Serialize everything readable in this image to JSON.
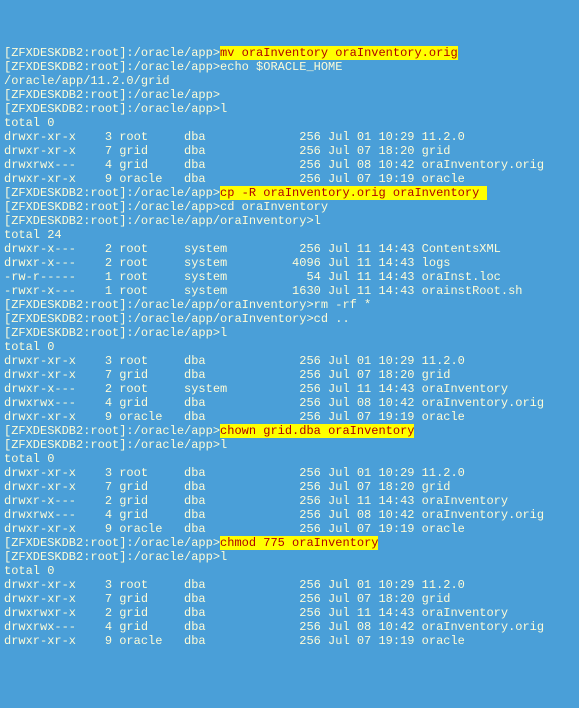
{
  "lines": [
    {
      "segments": [
        {
          "text": "[ZFXDESKDB2:root]:/oracle/app>"
        },
        {
          "text": "mv oraInventory oraInventory.orig",
          "hl": true
        }
      ]
    },
    {
      "segments": [
        {
          "text": "[ZFXDESKDB2:root]:/oracle/app>echo $ORACLE_HOME"
        }
      ]
    },
    {
      "segments": [
        {
          "text": "/oracle/app/11.2.0/grid"
        }
      ]
    },
    {
      "segments": [
        {
          "text": "[ZFXDESKDB2:root]:/oracle/app>"
        }
      ]
    },
    {
      "segments": [
        {
          "text": "[ZFXDESKDB2:root]:/oracle/app>l"
        }
      ]
    },
    {
      "segments": [
        {
          "text": "total 0"
        }
      ]
    },
    {
      "segments": [
        {
          "text": "drwxr-xr-x    3 root     dba             256 Jul 01 10:29 11.2.0"
        }
      ]
    },
    {
      "segments": [
        {
          "text": "drwxr-xr-x    7 grid     dba             256 Jul 07 18:20 grid"
        }
      ]
    },
    {
      "segments": [
        {
          "text": "drwxrwx---    4 grid     dba             256 Jul 08 10:42 oraInventory.orig"
        }
      ]
    },
    {
      "segments": [
        {
          "text": "drwxr-xr-x    9 oracle   dba             256 Jul 07 19:19 oracle"
        }
      ]
    },
    {
      "segments": [
        {
          "text": "[ZFXDESKDB2:root]:/oracle/app>"
        },
        {
          "text": "cp -R oraInventory.orig oraInventory ",
          "hl": true
        }
      ]
    },
    {
      "segments": [
        {
          "text": "[ZFXDESKDB2:root]:/oracle/app>cd oraInventory"
        }
      ]
    },
    {
      "segments": [
        {
          "text": "[ZFXDESKDB2:root]:/oracle/app/oraInventory>l"
        }
      ]
    },
    {
      "segments": [
        {
          "text": "total 24"
        }
      ]
    },
    {
      "segments": [
        {
          "text": "drwxr-x---    2 root     system          256 Jul 11 14:43 ContentsXML"
        }
      ]
    },
    {
      "segments": [
        {
          "text": "drwxr-x---    2 root     system         4096 Jul 11 14:43 logs"
        }
      ]
    },
    {
      "segments": [
        {
          "text": "-rw-r-----    1 root     system           54 Jul 11 14:43 oraInst.loc"
        }
      ]
    },
    {
      "segments": [
        {
          "text": "-rwxr-x---    1 root     system         1630 Jul 11 14:43 orainstRoot.sh"
        }
      ]
    },
    {
      "segments": [
        {
          "text": "[ZFXDESKDB2:root]:/oracle/app/oraInventory>rm -rf *"
        }
      ]
    },
    {
      "segments": [
        {
          "text": "[ZFXDESKDB2:root]:/oracle/app/oraInventory>cd .."
        }
      ]
    },
    {
      "segments": [
        {
          "text": "[ZFXDESKDB2:root]:/oracle/app>l"
        }
      ]
    },
    {
      "segments": [
        {
          "text": "total 0"
        }
      ]
    },
    {
      "segments": [
        {
          "text": "drwxr-xr-x    3 root     dba             256 Jul 01 10:29 11.2.0"
        }
      ]
    },
    {
      "segments": [
        {
          "text": "drwxr-xr-x    7 grid     dba             256 Jul 07 18:20 grid"
        }
      ]
    },
    {
      "segments": [
        {
          "text": "drwxr-x---    2 root     system          256 Jul 11 14:43 oraInventory"
        }
      ]
    },
    {
      "segments": [
        {
          "text": "drwxrwx---    4 grid     dba             256 Jul 08 10:42 oraInventory.orig"
        }
      ]
    },
    {
      "segments": [
        {
          "text": "drwxr-xr-x    9 oracle   dba             256 Jul 07 19:19 oracle"
        }
      ]
    },
    {
      "segments": [
        {
          "text": "[ZFXDESKDB2:root]:/oracle/app>"
        },
        {
          "text": "chown grid.dba oraInventory",
          "hl": true
        }
      ]
    },
    {
      "segments": [
        {
          "text": "[ZFXDESKDB2:root]:/oracle/app>l"
        }
      ]
    },
    {
      "segments": [
        {
          "text": "total 0"
        }
      ]
    },
    {
      "segments": [
        {
          "text": "drwxr-xr-x    3 root     dba             256 Jul 01 10:29 11.2.0"
        }
      ]
    },
    {
      "segments": [
        {
          "text": "drwxr-xr-x    7 grid     dba             256 Jul 07 18:20 grid"
        }
      ]
    },
    {
      "segments": [
        {
          "text": "drwxr-x---    2 grid     dba             256 Jul 11 14:43 oraInventory"
        }
      ]
    },
    {
      "segments": [
        {
          "text": "drwxrwx---    4 grid     dba             256 Jul 08 10:42 oraInventory.orig"
        }
      ]
    },
    {
      "segments": [
        {
          "text": "drwxr-xr-x    9 oracle   dba             256 Jul 07 19:19 oracle"
        }
      ]
    },
    {
      "segments": [
        {
          "text": "[ZFXDESKDB2:root]:/oracle/app>"
        },
        {
          "text": "chmod 775 oraInventory",
          "hl": true
        }
      ]
    },
    {
      "segments": [
        {
          "text": "[ZFXDESKDB2:root]:/oracle/app>l"
        }
      ]
    },
    {
      "segments": [
        {
          "text": "total 0"
        }
      ]
    },
    {
      "segments": [
        {
          "text": "drwxr-xr-x    3 root     dba             256 Jul 01 10:29 11.2.0"
        }
      ]
    },
    {
      "segments": [
        {
          "text": "drwxr-xr-x    7 grid     dba             256 Jul 07 18:20 grid"
        }
      ]
    },
    {
      "segments": [
        {
          "text": "drwxrwxr-x    2 grid     dba             256 Jul 11 14:43 oraInventory"
        }
      ]
    },
    {
      "segments": [
        {
          "text": "drwxrwx---    4 grid     dba             256 Jul 08 10:42 oraInventory.orig"
        }
      ]
    },
    {
      "segments": [
        {
          "text": "drwxr-xr-x    9 oracle   dba             256 Jul 07 19:19 oracle"
        }
      ]
    }
  ]
}
